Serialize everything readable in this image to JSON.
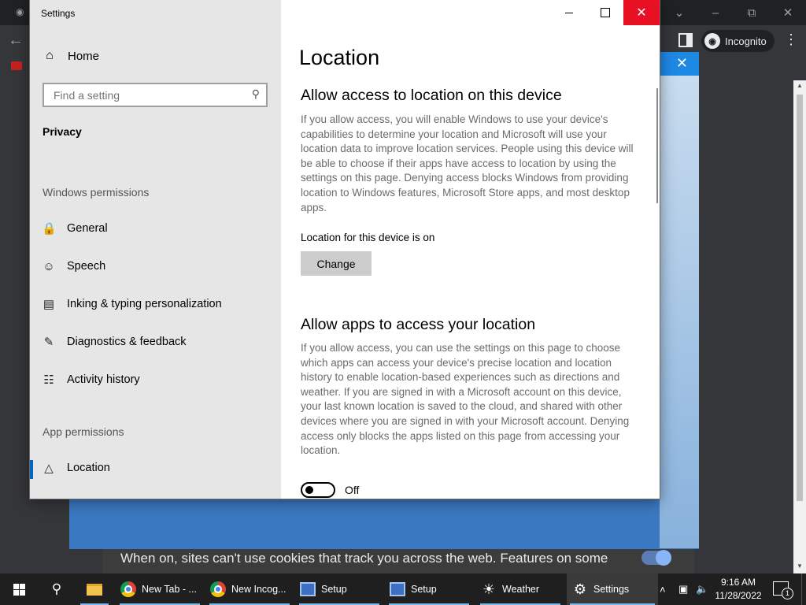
{
  "chrome": {
    "profile_label": "Incognito",
    "cookie_text": "When on, sites can't use cookies that track you across the web. Features on some"
  },
  "settings": {
    "app_title": "Settings",
    "nav": {
      "home": "Home",
      "search_placeholder": "Find a setting",
      "section": "Privacy",
      "windows_permissions_header": "Windows permissions",
      "windows_items": [
        {
          "label": "General",
          "icon": "lock-icon"
        },
        {
          "label": "Speech",
          "icon": "speech-icon"
        },
        {
          "label": "Inking & typing personalization",
          "icon": "clipboard-icon"
        },
        {
          "label": "Diagnostics & feedback",
          "icon": "feedback-icon"
        },
        {
          "label": "Activity history",
          "icon": "timeline-icon"
        }
      ],
      "app_permissions_header": "App permissions",
      "app_items": [
        {
          "label": "Location",
          "icon": "location-icon",
          "selected": true
        }
      ]
    },
    "content": {
      "title": "Location",
      "device_heading": "Allow access to location on this device",
      "device_text": "If you allow access, you will enable Windows to use your device's capabilities to determine your location and Microsoft will use your location data to improve location services. People using this device will be able to choose if their apps have access to location by using the settings on this page. Denying access blocks Windows from providing location to Windows features, Microsoft Store apps, and most desktop apps.",
      "device_status": "Location for this device is on",
      "change_button": "Change",
      "apps_heading": "Allow apps to access your location",
      "apps_text": "If you allow access, you can use the settings on this page to choose which apps can access your device's precise location and location history to enable location-based experiences such as directions and weather. If you are signed in with a Microsoft account on this device, your last known location is saved to the cloud, and shared with other devices where you are signed in with your Microsoft account. Denying access only blocks the apps listed on this page from accessing your location.",
      "apps_toggle_state": "Off"
    }
  },
  "taskbar": {
    "items": [
      {
        "label": "New Tab - ...",
        "icon": "chrome-icon"
      },
      {
        "label": "New Incog...",
        "icon": "chrome-icon"
      },
      {
        "label": "Setup",
        "icon": "setup-icon"
      },
      {
        "label": "Setup",
        "icon": "setup-icon"
      },
      {
        "label": "Weather",
        "icon": "weather-sun-icon"
      },
      {
        "label": "Settings",
        "icon": "gear-icon"
      }
    ],
    "time": "9:16 AM",
    "date": "11/28/2022",
    "notification_count": "1"
  }
}
